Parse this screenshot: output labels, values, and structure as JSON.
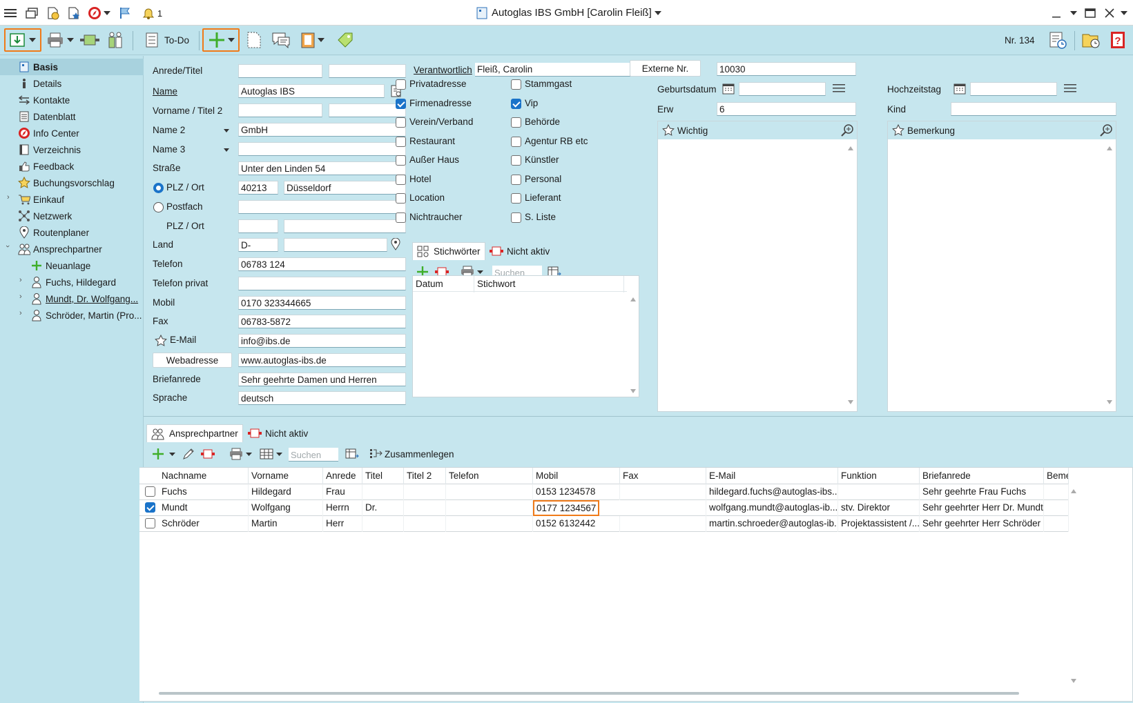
{
  "window": {
    "title": "Autoglas IBS GmbH  [Carolin Fleiß]",
    "notification_count": "1"
  },
  "toolbar": {
    "todo_label": "To-Do",
    "record_number": "Nr. 134"
  },
  "sidebar": {
    "items": [
      {
        "label": "Basis"
      },
      {
        "label": "Details"
      },
      {
        "label": "Kontakte"
      },
      {
        "label": "Datenblatt"
      },
      {
        "label": "Info Center"
      },
      {
        "label": "Verzeichnis"
      },
      {
        "label": "Feedback"
      },
      {
        "label": "Buchungsvorschlag"
      },
      {
        "label": "Einkauf"
      },
      {
        "label": "Netzwerk"
      },
      {
        "label": "Routenplaner"
      },
      {
        "label": "Ansprechpartner"
      },
      {
        "label": "Neuanlage"
      },
      {
        "label": "Fuchs, Hildegard"
      },
      {
        "label": "Mundt, Dr. Wolfgang..."
      },
      {
        "label": "Schröder, Martin (Pro..."
      }
    ]
  },
  "form": {
    "labels": {
      "anrede": "Anrede/Titel",
      "name": "Name",
      "vorname": "Vorname / Titel 2",
      "name2": "Name 2",
      "name3": "Name 3",
      "strasse": "Straße",
      "plz_ort": "PLZ / Ort",
      "postfach": "Postfach",
      "plz_ort2": "PLZ / Ort",
      "land": "Land",
      "telefon": "Telefon",
      "telefon_privat": "Telefon privat",
      "mobil": "Mobil",
      "fax": "Fax",
      "email": "E-Mail",
      "webadresse": "Webadresse",
      "briefanrede": "Briefanrede",
      "sprache": "Sprache",
      "verantwortlich": "Verantwortlich",
      "externe_nr": "Externe Nr.",
      "geburtsdatum": "Geburtsdatum",
      "hochzeitstag": "Hochzeitstag",
      "erw": "Erw",
      "kind": "Kind"
    },
    "values": {
      "name": "Autoglas IBS",
      "name2": "GmbH",
      "strasse": "Unter den Linden 54",
      "plz": "40213",
      "ort": "Düsseldorf",
      "land": "D-",
      "telefon": "06783 124",
      "mobil": "0170 323344665",
      "fax": "06783-5872",
      "email": "info@ibs.de",
      "webadresse": "www.autoglas-ibs.de",
      "briefanrede": "Sehr geehrte Damen und Herren",
      "sprache": "deutsch",
      "verantwortlich": "Fleiß, Carolin",
      "externe_nr": "10030",
      "erw": "6"
    }
  },
  "checkboxes": {
    "left": [
      {
        "label": "Privatadresse",
        "checked": false
      },
      {
        "label": "Firmenadresse",
        "checked": true
      },
      {
        "label": "Verein/Verband",
        "checked": false
      },
      {
        "label": "Restaurant",
        "checked": false
      },
      {
        "label": "Außer Haus",
        "checked": false
      },
      {
        "label": "Hotel",
        "checked": false
      },
      {
        "label": "Location",
        "checked": false
      },
      {
        "label": "Nichtraucher",
        "checked": false
      }
    ],
    "right": [
      {
        "label": "Stammgast",
        "checked": false
      },
      {
        "label": "Vip",
        "checked": true
      },
      {
        "label": "Behörde",
        "checked": false
      },
      {
        "label": "Agentur RB etc",
        "checked": false
      },
      {
        "label": "Künstler",
        "checked": false
      },
      {
        "label": "Personal",
        "checked": false
      },
      {
        "label": "Lieferant",
        "checked": false
      },
      {
        "label": "S. Liste",
        "checked": false
      }
    ]
  },
  "keywords": {
    "tab_active": "Stichwörter",
    "tab_inactive": "Nicht aktiv",
    "search_placeholder": "Suchen",
    "columns": [
      "Datum",
      "Stichwort"
    ]
  },
  "notes": {
    "wichtig": "Wichtig",
    "bemerkung": "Bemerkung"
  },
  "contacts": {
    "tab_active": "Ansprechpartner",
    "tab_inactive": "Nicht aktiv",
    "search_placeholder": "Suchen",
    "merge_label": "Zusammenlegen",
    "columns": [
      "Nachname",
      "Vorname",
      "Anrede",
      "Titel",
      "Titel 2",
      "Telefon",
      "Mobil",
      "Fax",
      "E-Mail",
      "Funktion",
      "Briefanrede",
      "Beme"
    ],
    "rows": [
      {
        "checked": false,
        "cells": [
          "Fuchs",
          "Hildegard",
          "Frau",
          "",
          "",
          "",
          "0153 1234578",
          "",
          "hildegard.fuchs@autoglas-ibs....",
          "",
          "Sehr geehrte Frau Fuchs",
          ""
        ]
      },
      {
        "checked": true,
        "cells": [
          "Mundt",
          "Wolfgang",
          "Herrn",
          "Dr.",
          "",
          "",
          "0177 1234567",
          "",
          "wolfgang.mundt@autoglas-ib...",
          "stv. Direktor",
          "Sehr geehrter Herr Dr. Mundt",
          ""
        ]
      },
      {
        "checked": false,
        "cells": [
          "Schröder",
          "Martin",
          "Herr",
          "",
          "",
          "",
          "0152 6132442",
          "",
          "martin.schroeder@autoglas-ib...",
          "Projektassistent /...",
          "Sehr geehrter Herr Schröder",
          ""
        ]
      }
    ]
  },
  "colors": {
    "accent_highlight": "#f07a18",
    "background": "#bfe3ec",
    "checkbox_on": "#1a73c9"
  }
}
